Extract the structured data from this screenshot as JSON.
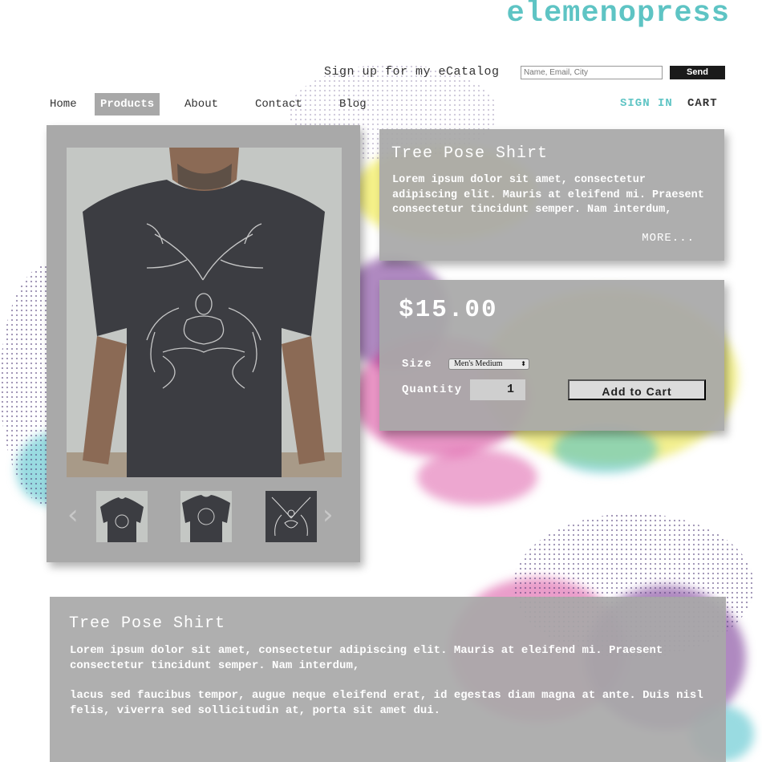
{
  "brand": {
    "logo": "elemenopress",
    "accent": "#5ec4c4"
  },
  "signup": {
    "label": "Sign up for my eCatalog",
    "placeholder": "Name, Email, City",
    "button": "Send"
  },
  "nav": {
    "items": [
      {
        "label": "Home",
        "active": false
      },
      {
        "label": "Products",
        "active": true
      },
      {
        "label": "About",
        "active": false
      },
      {
        "label": "Contact",
        "active": false
      },
      {
        "label": "Blog",
        "active": false
      }
    ],
    "sign_in": "SIGN IN",
    "cart": "CART"
  },
  "product": {
    "title": "Tree Pose Shirt",
    "short_description": "Lorem ipsum dolor sit amet, consectetur adipiscing elit. Mauris at eleifend mi. Praesent consectetur tincidunt semper. Nam interdum,",
    "more": "MORE...",
    "price": "$15.00",
    "size_label": "Size",
    "size_selected": "Men's Medium",
    "quantity_label": "Quantity",
    "quantity": "1",
    "add_to_cart": "Add to Cart"
  },
  "gallery": {
    "prev_icon": "chevron-left-icon",
    "next_icon": "chevron-right-icon",
    "thumbnails": [
      "shirt-front-thumbnail",
      "shirt-front-closeup-thumbnail",
      "shirt-print-detail-thumbnail"
    ]
  },
  "details": {
    "title": "Tree Pose Shirt",
    "paragraph1": "Lorem ipsum dolor sit amet, consectetur adipiscing elit. Mauris at eleifend mi. Praesent consectetur tincidunt semper. Nam interdum,",
    "paragraph2": "lacus sed faucibus tempor, augue neque eleifend erat, id egestas diam magna at ante. Duis nisl felis, viverra sed sollicitudin at, porta sit amet dui."
  }
}
